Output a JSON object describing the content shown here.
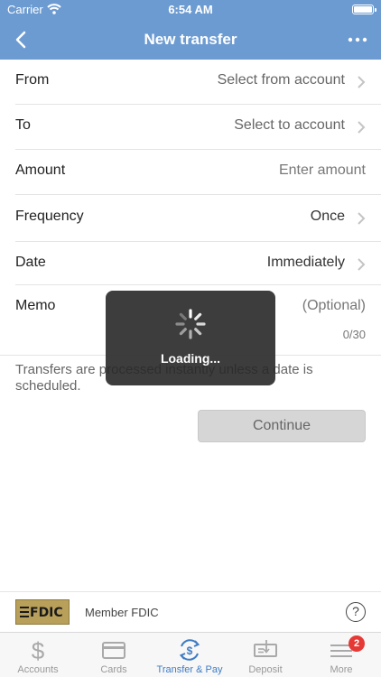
{
  "status_bar": {
    "carrier": "Carrier",
    "time": "6:54 AM"
  },
  "nav": {
    "title": "New transfer"
  },
  "form": {
    "from": {
      "label": "From",
      "value": "Select from account"
    },
    "to": {
      "label": "To",
      "value": "Select to account"
    },
    "amount": {
      "label": "Amount",
      "placeholder": "Enter amount"
    },
    "frequency": {
      "label": "Frequency",
      "value": "Once"
    },
    "date": {
      "label": "Date",
      "value": "Immediately"
    },
    "memo": {
      "label": "Memo",
      "placeholder": "(Optional)",
      "counter": "0/30"
    }
  },
  "note": "Transfers are processed instantly unless a date is scheduled.",
  "continue_label": "Continue",
  "loading": {
    "text": "Loading..."
  },
  "footer": {
    "fdic_logo": "FDIC",
    "member_text": "Member FDIC",
    "help": "?"
  },
  "tabs": [
    {
      "label": "Accounts",
      "icon": "dollar-icon",
      "active": false
    },
    {
      "label": "Cards",
      "icon": "card-icon",
      "active": false
    },
    {
      "label": "Transfer & Pay",
      "icon": "transfer-pay-icon",
      "active": true
    },
    {
      "label": "Deposit",
      "icon": "check-deposit-icon",
      "active": false
    },
    {
      "label": "More",
      "icon": "menu-icon",
      "active": false,
      "badge": "2"
    }
  ],
  "colors": {
    "header": "#6c9bd2",
    "active_tab": "#3f7cc4",
    "badge": "#e53935"
  }
}
